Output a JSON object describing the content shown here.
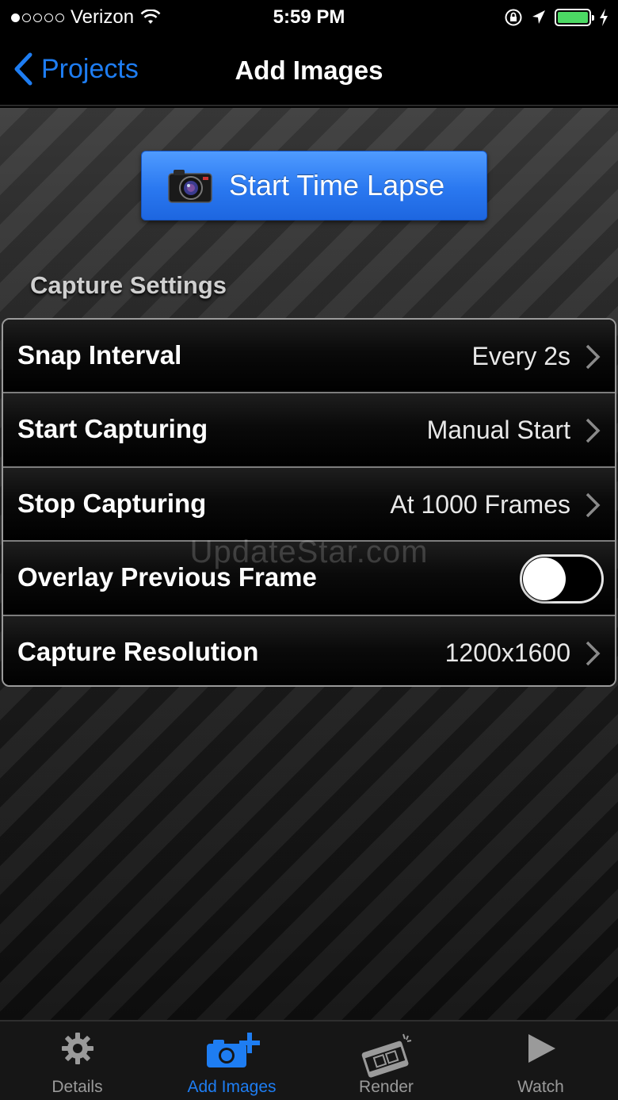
{
  "status_bar": {
    "carrier": "Verizon",
    "signal_bars": 1,
    "time": "5:59 PM",
    "battery_color": "#4cd964"
  },
  "nav": {
    "back_label": "Projects",
    "title": "Add Images"
  },
  "start_button": {
    "label": "Start Time Lapse"
  },
  "capture_settings": {
    "title": "Capture Settings",
    "rows": [
      {
        "label": "Snap Interval",
        "value": "Every 2s"
      },
      {
        "label": "Start Capturing",
        "value": "Manual Start"
      },
      {
        "label": "Stop Capturing",
        "value": "At 1000 Frames"
      },
      {
        "label": "Overlay Previous Frame",
        "toggle_on": false
      },
      {
        "label": "Capture Resolution",
        "value": "1200x1600"
      }
    ]
  },
  "watermark": "UpdateStar.com",
  "tab_bar": {
    "accent_color": "#1e7df2",
    "tabs": [
      {
        "label": "Details",
        "icon": "gear-icon"
      },
      {
        "label": "Add Images",
        "icon": "camera-plus-icon",
        "active": true
      },
      {
        "label": "Render",
        "icon": "clapperboard-icon"
      },
      {
        "label": "Watch",
        "icon": "play-icon"
      }
    ]
  }
}
